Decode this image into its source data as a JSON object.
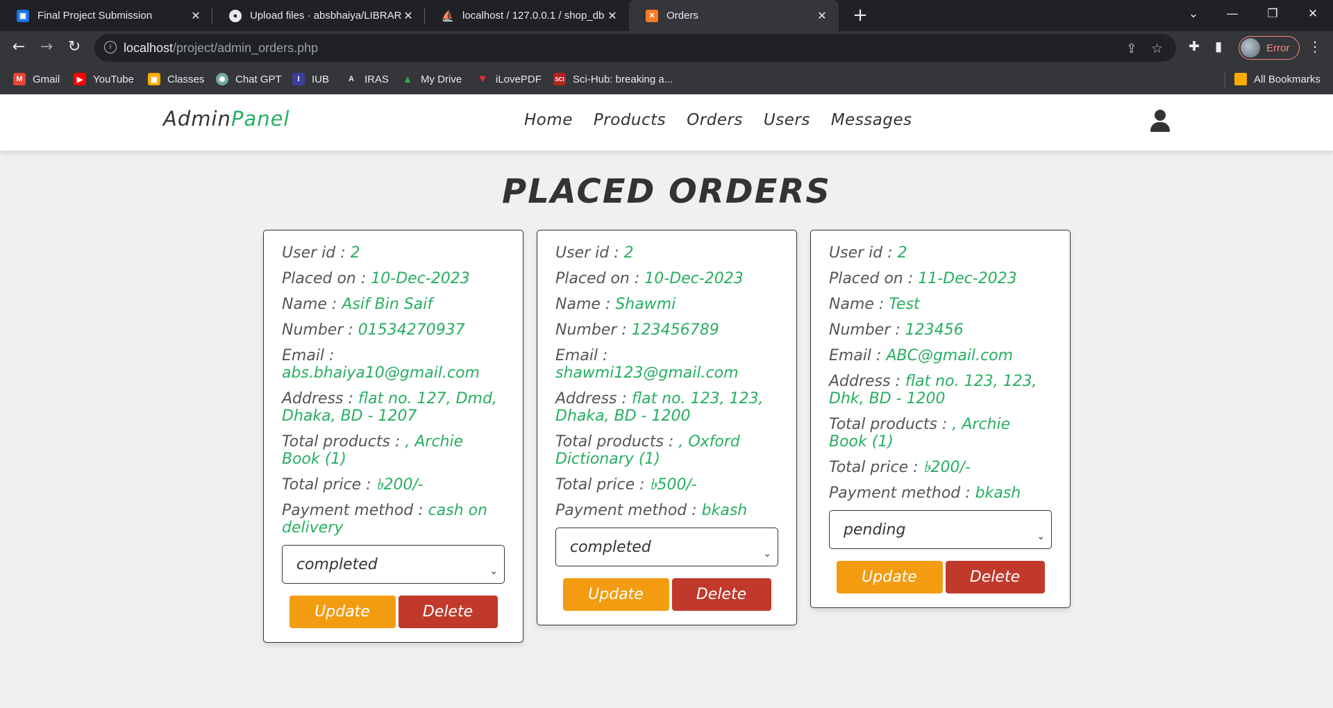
{
  "browser": {
    "tabs": [
      {
        "title": "Final Project Submission",
        "icon": "google-classroom-icon",
        "active": false
      },
      {
        "title": "Upload files · absbhaiya/LIBRARY",
        "icon": "github-icon",
        "active": false
      },
      {
        "title": "localhost / 127.0.0.1 / shop_db /",
        "icon": "phpmyadmin-icon",
        "active": false
      },
      {
        "title": "Orders",
        "icon": "xampp-icon",
        "active": true
      }
    ],
    "url_host": "localhost",
    "url_path": "/project/admin_orders.php",
    "profile_label": "Error",
    "bookmarks": [
      {
        "label": "Gmail",
        "icon": "gmail-icon",
        "color": "#ea4335"
      },
      {
        "label": "YouTube",
        "icon": "youtube-icon",
        "color": "#ff0000"
      },
      {
        "label": "Classes",
        "icon": "google-classroom-icon",
        "color": "#f9ab00"
      },
      {
        "label": "Chat GPT",
        "icon": "chatgpt-icon",
        "color": "#74aa9c"
      },
      {
        "label": "IUB",
        "icon": "iub-icon",
        "color": "#3b3f99"
      },
      {
        "label": "IRAS",
        "icon": "iras-icon",
        "color": "#202124"
      },
      {
        "label": "My Drive",
        "icon": "google-drive-icon",
        "color": "#34a853"
      },
      {
        "label": "iLovePDF",
        "icon": "ilovepdf-icon",
        "color": "#e5322d"
      },
      {
        "label": "Sci-Hub: breaking a...",
        "icon": "scihub-icon",
        "color": "#b22222"
      }
    ],
    "all_bookmarks": "All Bookmarks"
  },
  "header": {
    "logo_main": "Admin",
    "logo_accent": "Panel",
    "nav": [
      "Home",
      "Products",
      "Orders",
      "Users",
      "Messages"
    ]
  },
  "page_title": "PLACED ORDERS",
  "labels": {
    "user_id": "User id : ",
    "placed_on": "Placed on : ",
    "name": "Name : ",
    "number": "Number : ",
    "email": "Email : ",
    "address": "Address : ",
    "total_products": "Total products : ",
    "total_price": "Total price : ",
    "payment_method": "Payment method : ",
    "update": "Update",
    "delete": "Delete"
  },
  "orders": [
    {
      "user_id": "2",
      "placed_on": "10-Dec-2023",
      "name": "Asif Bin Saif",
      "number": "01534270937",
      "email": "abs.bhaiya10@gmail.com",
      "address": "flat no. 127, Dmd, Dhaka, BD - 1207",
      "total_products": ", Archie Book (1)",
      "total_price": "৳200/-",
      "payment_method": "cash on delivery",
      "status": "completed"
    },
    {
      "user_id": "2",
      "placed_on": "10-Dec-2023",
      "name": "Shawmi",
      "number": "123456789",
      "email": "shawmi123@gmail.com",
      "address": "flat no. 123, 123, Dhaka, BD - 1200",
      "total_products": ", Oxford Dictionary (1)",
      "total_price": "৳500/-",
      "payment_method": "bkash",
      "status": "completed"
    },
    {
      "user_id": "2",
      "placed_on": "11-Dec-2023",
      "name": "Test",
      "number": "123456",
      "email": "ABC@gmail.com",
      "address": "flat no. 123, 123, Dhk, BD - 1200",
      "total_products": ", Archie Book (1)",
      "total_price": "৳200/-",
      "payment_method": "bkash",
      "status": "pending"
    }
  ],
  "colors": {
    "accent_green": "#27ae60",
    "update_orange": "#f39c12",
    "delete_red": "#c0392b"
  }
}
